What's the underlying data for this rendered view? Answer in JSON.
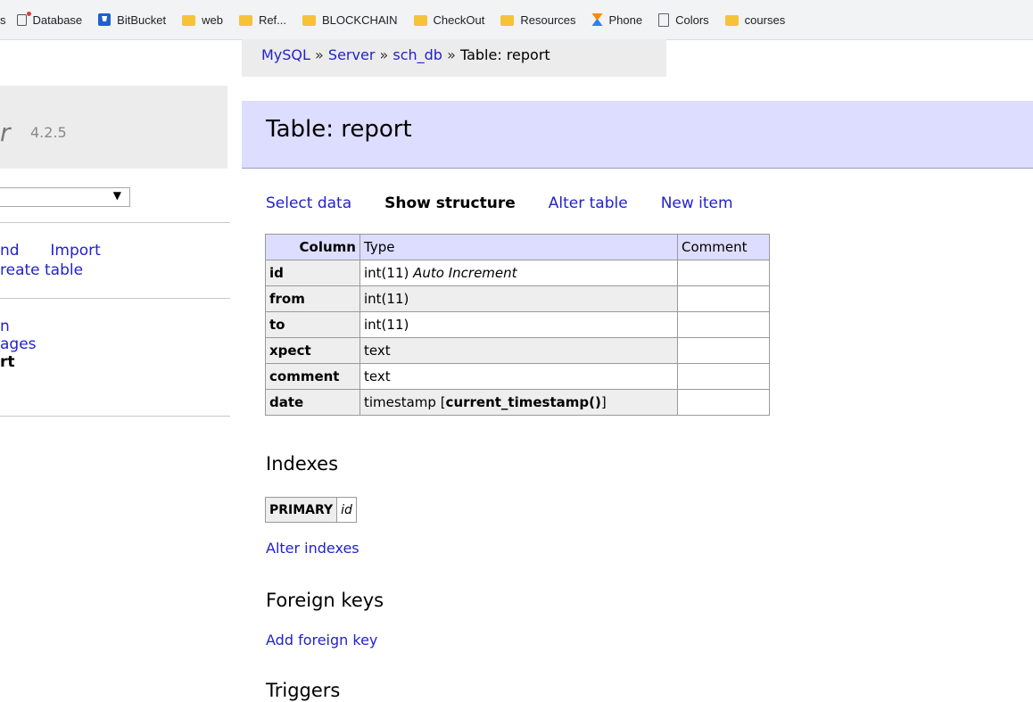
{
  "bookmarks": [
    {
      "label": "s",
      "icon": "none"
    },
    {
      "label": "Database",
      "icon": "database-icon"
    },
    {
      "label": "BitBucket",
      "icon": "bitbucket-icon"
    },
    {
      "label": "web",
      "icon": "folder-icon"
    },
    {
      "label": "Ref...",
      "icon": "folder-icon"
    },
    {
      "label": "BLOCKCHAIN",
      "icon": "folder-icon"
    },
    {
      "label": "CheckOut",
      "icon": "folder-icon"
    },
    {
      "label": "Resources",
      "icon": "folder-icon"
    },
    {
      "label": "Phone",
      "icon": "hourglass-icon"
    },
    {
      "label": "Colors",
      "icon": "page-icon"
    },
    {
      "label": "courses",
      "icon": "folder-icon"
    }
  ],
  "breadcrumb": {
    "items": [
      "MySQL",
      "Server",
      "sch_db"
    ],
    "separator": "»",
    "current": "Table: report"
  },
  "sidebar": {
    "logo_fragment": "r",
    "version": "4.2.5",
    "select_arrow": "▼",
    "links_row1": [
      "nd",
      "Import"
    ],
    "links_row2": "reate table",
    "tables": [
      "n",
      "ages",
      "rt"
    ]
  },
  "header": {
    "title": "Table: report"
  },
  "actions": {
    "select_data": "Select data",
    "show_structure": "Show structure",
    "alter_table": "Alter table",
    "new_item": "New item"
  },
  "structure": {
    "headers": [
      "Column",
      "Type",
      "Comment"
    ],
    "rows": [
      {
        "column": "id",
        "type": "int(11)",
        "extra": "Auto Increment",
        "comment": ""
      },
      {
        "column": "from",
        "type": "int(11)",
        "extra": "",
        "comment": ""
      },
      {
        "column": "to",
        "type": "int(11)",
        "extra": "",
        "comment": ""
      },
      {
        "column": "xpect",
        "type": "text",
        "extra": "",
        "comment": ""
      },
      {
        "column": "comment",
        "type": "text",
        "extra": "",
        "comment": ""
      },
      {
        "column": "date",
        "type": "timestamp",
        "default": "current_timestamp()",
        "comment": ""
      }
    ]
  },
  "indexes": {
    "title": "Indexes",
    "type": "PRIMARY",
    "column": "id",
    "alter_label": "Alter indexes"
  },
  "foreign_keys": {
    "title": "Foreign keys",
    "add_label": "Add foreign key"
  },
  "triggers": {
    "title": "Triggers"
  },
  "colors": {
    "header_bg": "#ddddff",
    "link": "#2222cc",
    "panel_bg": "#ececec"
  }
}
